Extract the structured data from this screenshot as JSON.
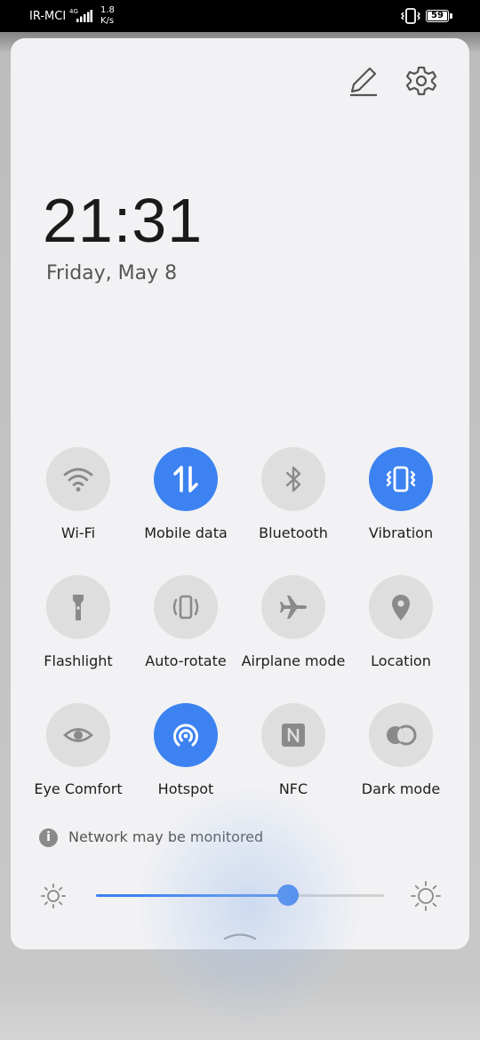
{
  "status_bar": {
    "carrier": "IR-MCI",
    "network_type": "4G",
    "speed_value": "1.8",
    "speed_unit": "K/s",
    "battery": "59"
  },
  "header": {
    "edit_icon": "pencil-icon",
    "settings_icon": "gear-icon"
  },
  "clock": {
    "time": "21:31",
    "date": "Friday, May 8"
  },
  "tiles": [
    {
      "label": "Wi-Fi",
      "icon": "wifi-icon",
      "active": false
    },
    {
      "label": "Mobile data",
      "icon": "mobile-data-icon",
      "active": true
    },
    {
      "label": "Bluetooth",
      "icon": "bluetooth-icon",
      "active": false
    },
    {
      "label": "Vibration",
      "icon": "vibration-icon",
      "active": true
    },
    {
      "label": "Flashlight",
      "icon": "flashlight-icon",
      "active": false
    },
    {
      "label": "Auto-rotate",
      "icon": "auto-rotate-icon",
      "active": false
    },
    {
      "label": "Airplane mode",
      "icon": "airplane-icon",
      "active": false
    },
    {
      "label": "Location",
      "icon": "location-pin-icon",
      "active": false
    },
    {
      "label": "Eye Comfort",
      "icon": "eye-icon",
      "active": false
    },
    {
      "label": "Hotspot",
      "icon": "hotspot-icon",
      "active": true
    },
    {
      "label": "NFC",
      "icon": "nfc-icon",
      "active": false
    },
    {
      "label": "Dark mode",
      "icon": "dark-mode-icon",
      "active": false
    }
  ],
  "notice": {
    "text": "Network may be monitored",
    "icon": "info-icon"
  },
  "brightness": {
    "level": 0.667,
    "low_icon": "brightness-low-icon",
    "high_icon": "brightness-high-icon"
  },
  "colors": {
    "accent": "#3c82f0",
    "tile_off": "#dedede",
    "icon_off": "#8a8a8a"
  }
}
